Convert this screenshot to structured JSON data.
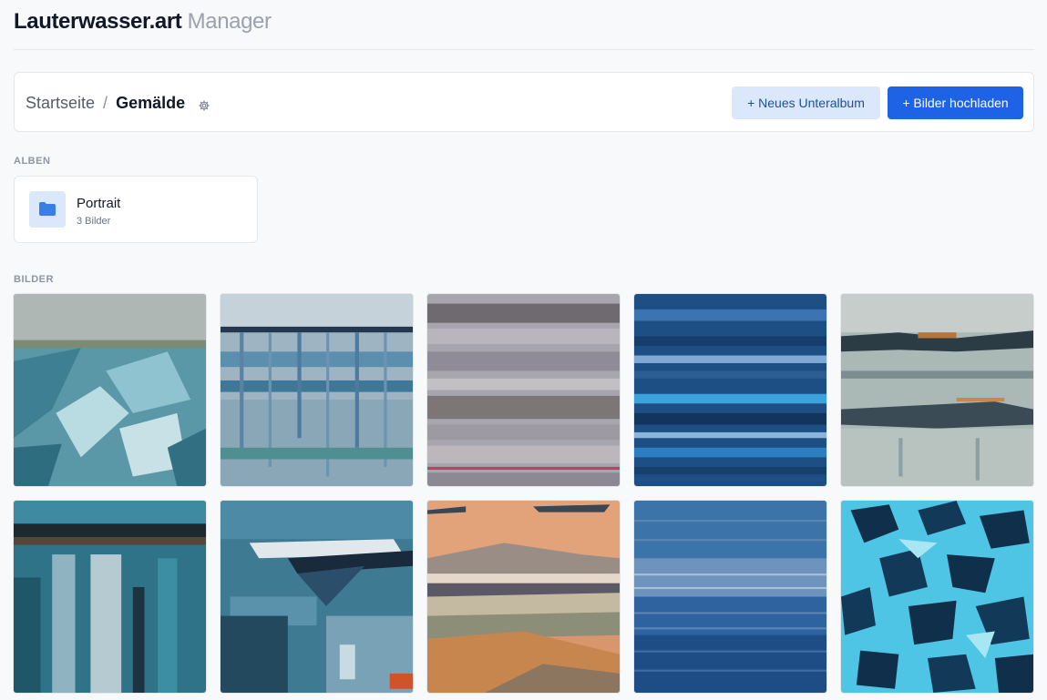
{
  "header": {
    "brand": "Lauterwasser.art",
    "subtitle": "Manager"
  },
  "breadcrumb": {
    "home": "Startseite",
    "separator": "/",
    "current": "Gemälde"
  },
  "toolbar": {
    "new_subalbum": "+ Neues Unteralbum",
    "upload": "+ Bilder hochladen"
  },
  "albums": {
    "section_label": "ALBEN",
    "items": [
      {
        "name": "Portrait",
        "count": "3 Bilder"
      }
    ]
  },
  "images": {
    "section_label": "BILDER"
  },
  "colors": {
    "accent": "#1e63e6",
    "accent_soft": "#dbe7fb",
    "background": "#f8f9fa",
    "folder_icon": "#3b7de8"
  }
}
